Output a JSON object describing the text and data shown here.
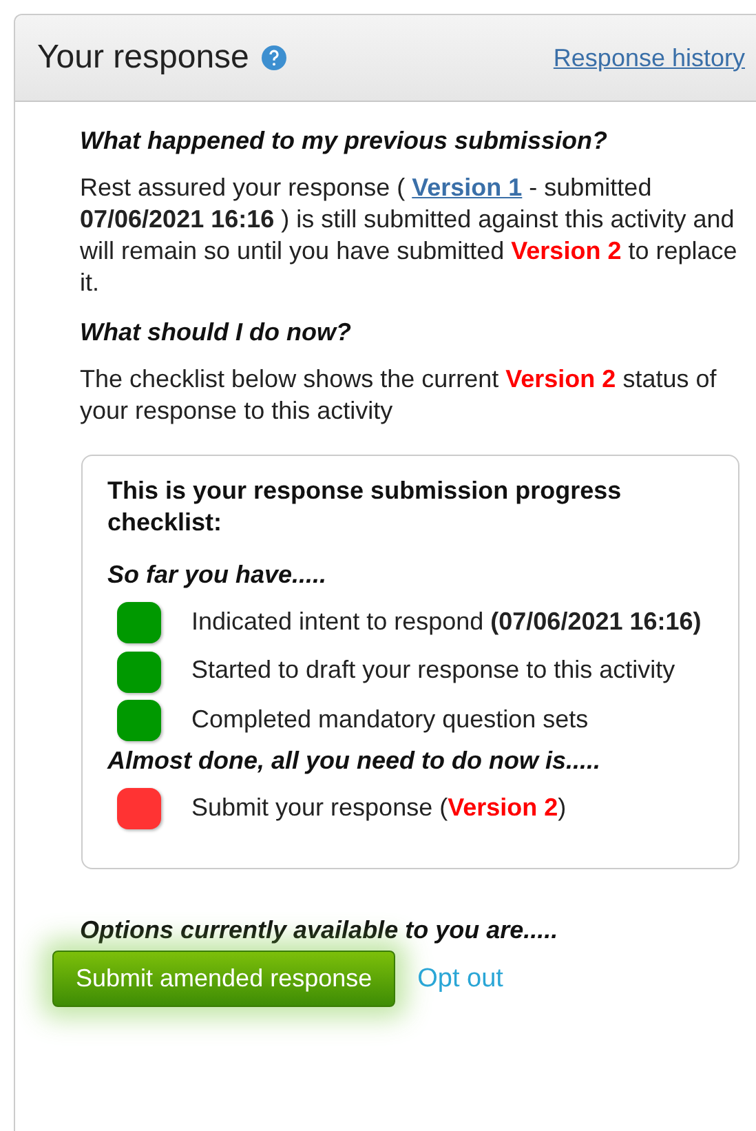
{
  "panel": {
    "title": "Your response",
    "history_link": "Response history"
  },
  "sections": [
    {
      "heading": "What happened to my previous submission?",
      "paragraph": [
        {
          "kind": "plain",
          "text": "Rest assured your response ( "
        },
        {
          "kind": "link",
          "text": "Version 1"
        },
        {
          "kind": "plain",
          "text": " - submitted "
        },
        {
          "kind": "bold",
          "text": "07/06/2021 16:16"
        },
        {
          "kind": "plain",
          "text": " ) is still submitted against this activity and will remain so until you have submitted "
        },
        {
          "kind": "highlight",
          "text": "Version 2"
        },
        {
          "kind": "plain",
          "text": " to replace it."
        }
      ]
    },
    {
      "heading": "What should I do now?",
      "paragraph": [
        {
          "kind": "plain",
          "text": "The checklist below shows the current "
        },
        {
          "kind": "highlight",
          "text": "Version 2"
        },
        {
          "kind": "plain",
          "text": " status of your response to this activity"
        }
      ]
    }
  ],
  "checklist": {
    "title": "This is your response submission progress checklist:",
    "groups": [
      {
        "heading": "So far you have.....",
        "items": [
          {
            "color": "#009900",
            "text": [
              {
                "kind": "plain",
                "text": "Indicated intent to respond "
              },
              {
                "kind": "bold",
                "text": "(07/06/2021 16:16)"
              }
            ]
          },
          {
            "color": "#009900",
            "text": [
              {
                "kind": "plain",
                "text": "Started to draft your response to this activity"
              }
            ]
          },
          {
            "color": "#009900",
            "text": [
              {
                "kind": "plain",
                "text": "Completed mandatory question sets"
              }
            ]
          }
        ]
      },
      {
        "heading": "Almost done, all you need to do now is.....",
        "items": [
          {
            "color": "#ff3333",
            "text": [
              {
                "kind": "plain",
                "text": "Submit your response ("
              },
              {
                "kind": "highlight",
                "text": "Version 2"
              },
              {
                "kind": "plain",
                "text": ")"
              }
            ]
          }
        ]
      }
    ]
  },
  "options": {
    "heading": "Options currently available to you are.....",
    "submit_button": "Submit amended response",
    "opt_out_link": "Opt out"
  }
}
